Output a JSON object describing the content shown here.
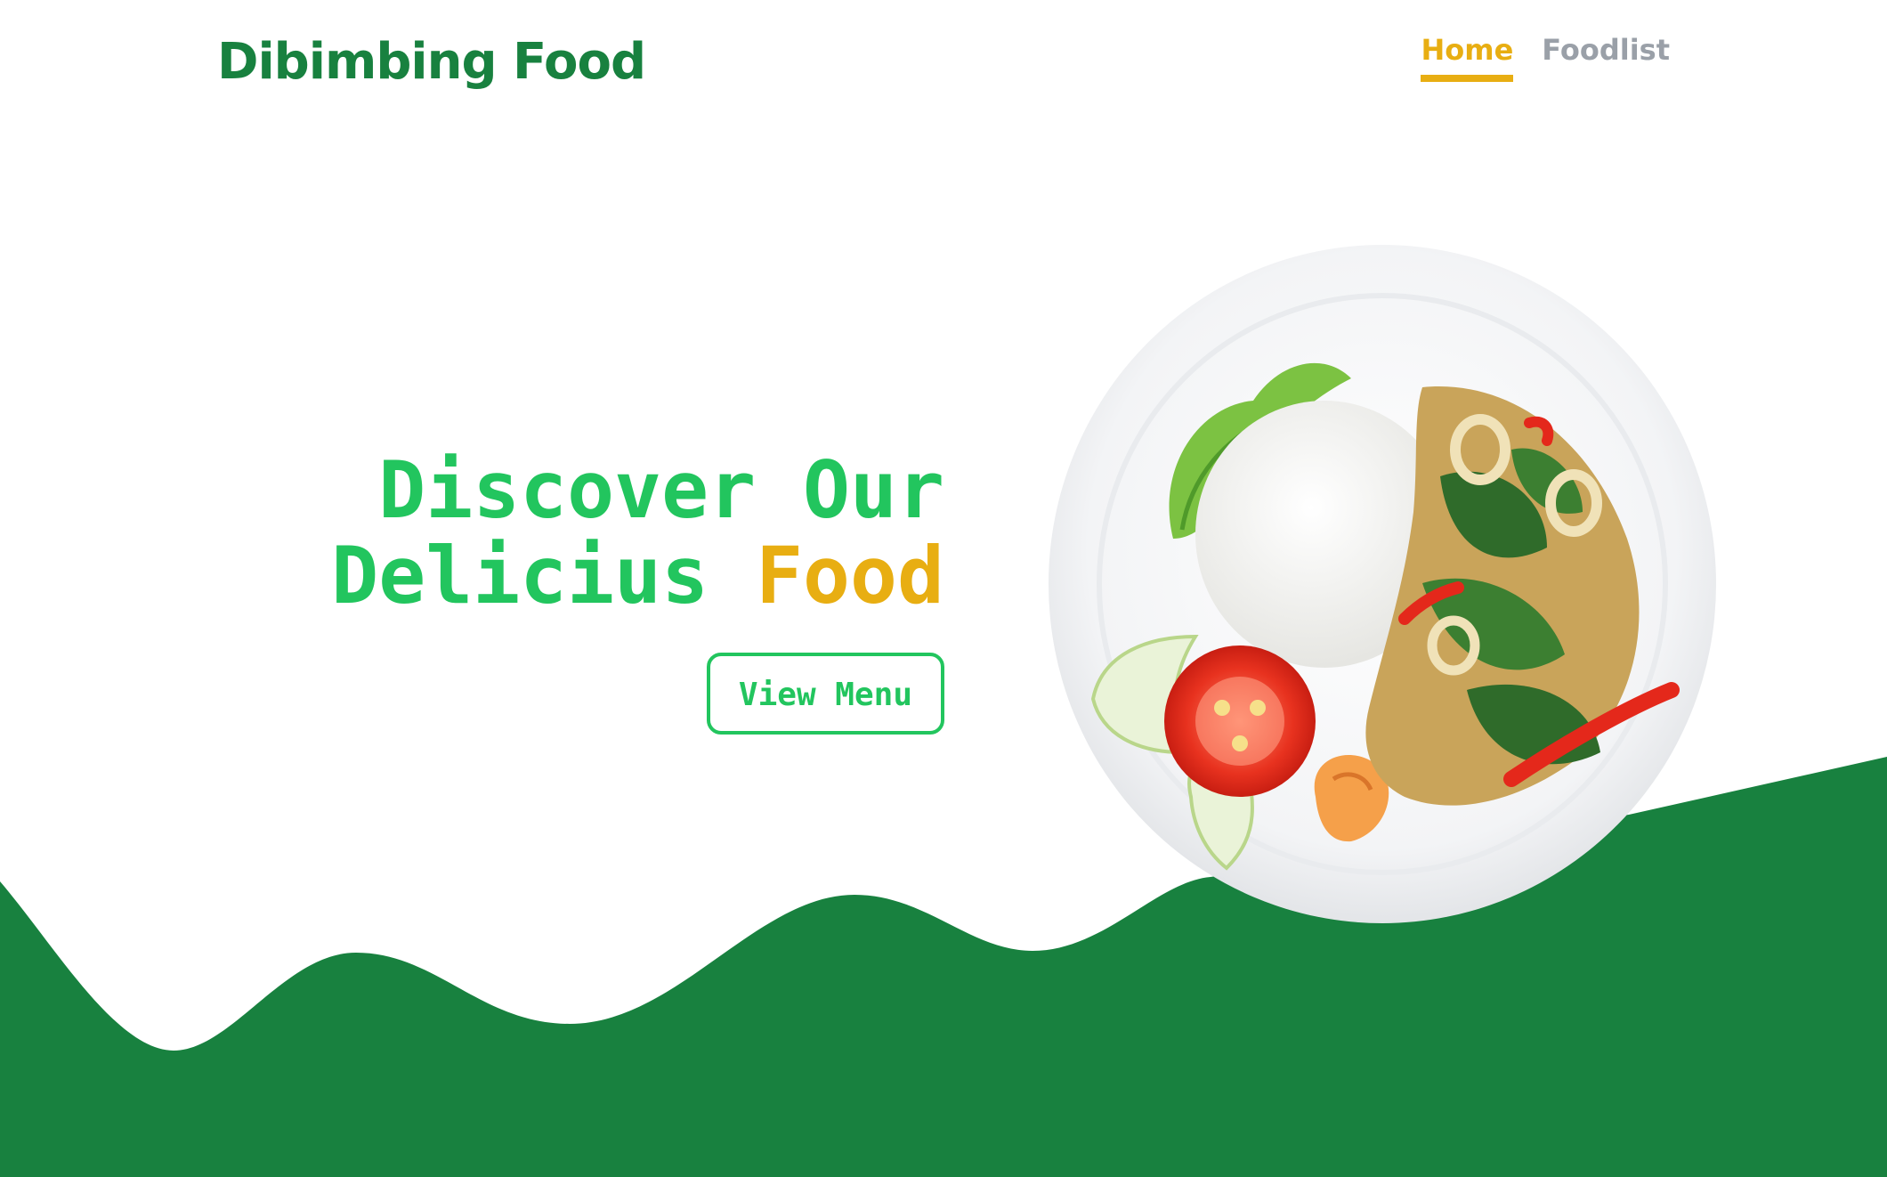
{
  "header": {
    "brand": "Dibimbing Food",
    "nav": [
      {
        "label": "Home",
        "active": true
      },
      {
        "label": "Foodlist",
        "active": false
      }
    ]
  },
  "hero": {
    "title_line1": "Discover Our",
    "title_line2_main": "Delicius ",
    "title_line2_accent": "Food",
    "cta_label": "View Menu",
    "image": "plate-of-rice-with-squid-basil-stir-fry-tomato-cucumber-shrimp"
  },
  "colors": {
    "brand_green": "#18813f",
    "accent_green": "#22c55e",
    "accent_yellow": "#e8ae12",
    "nav_inactive": "#9aa0a8",
    "background": "#ffffff"
  }
}
